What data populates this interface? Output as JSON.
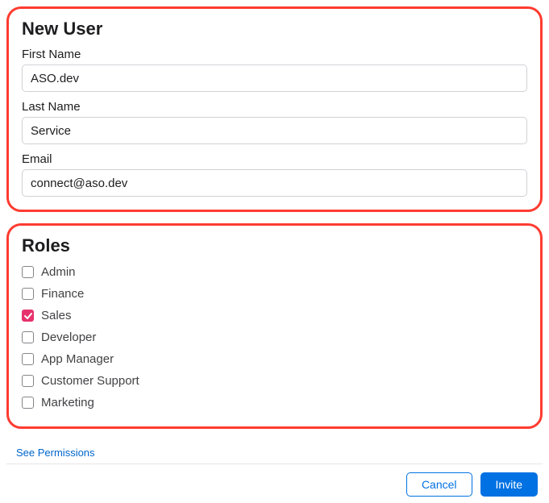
{
  "newUser": {
    "title": "New User",
    "firstNameLabel": "First Name",
    "firstNameValue": "ASO.dev",
    "lastNameLabel": "Last Name",
    "lastNameValue": "Service",
    "emailLabel": "Email",
    "emailValue": "connect@aso.dev"
  },
  "roles": {
    "title": "Roles",
    "items": [
      {
        "label": "Admin",
        "checked": false
      },
      {
        "label": "Finance",
        "checked": false
      },
      {
        "label": "Sales",
        "checked": true
      },
      {
        "label": "Developer",
        "checked": false
      },
      {
        "label": "App Manager",
        "checked": false
      },
      {
        "label": "Customer Support",
        "checked": false
      },
      {
        "label": "Marketing",
        "checked": false
      }
    ]
  },
  "permissionsLink": "See Permissions",
  "footer": {
    "cancel": "Cancel",
    "invite": "Invite"
  },
  "colors": {
    "highlight": "#ff3b30",
    "checkbox_checked": "#e6336d",
    "primary": "#0071e3"
  }
}
